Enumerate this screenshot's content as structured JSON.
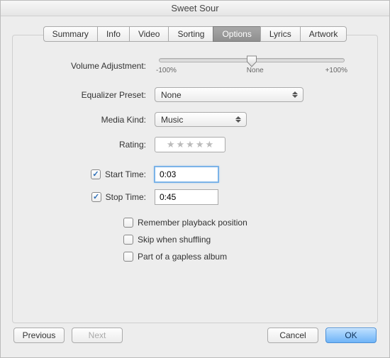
{
  "window": {
    "title": "Sweet Sour"
  },
  "tabs": {
    "items": [
      {
        "label": "Summary"
      },
      {
        "label": "Info"
      },
      {
        "label": "Video"
      },
      {
        "label": "Sorting"
      },
      {
        "label": "Options"
      },
      {
        "label": "Lyrics"
      },
      {
        "label": "Artwork"
      }
    ],
    "active_index": 4
  },
  "volume": {
    "label": "Volume Adjustment:",
    "ticks": {
      "min": "-100%",
      "mid": "None",
      "max": "+100%"
    },
    "value_percent": 50
  },
  "equalizer": {
    "label": "Equalizer Preset:",
    "value": "None"
  },
  "media_kind": {
    "label": "Media Kind:",
    "value": "Music"
  },
  "rating": {
    "label": "Rating:",
    "stars": 0
  },
  "start_time": {
    "label": "Start Time:",
    "checked": true,
    "value": "0:03"
  },
  "stop_time": {
    "label": "Stop Time:",
    "checked": true,
    "value": "0:45"
  },
  "remember": {
    "label": "Remember playback position",
    "checked": false
  },
  "skip": {
    "label": "Skip when shuffling",
    "checked": false
  },
  "gapless": {
    "label": "Part of a gapless album",
    "checked": false
  },
  "footer": {
    "previous": "Previous",
    "next": "Next",
    "cancel": "Cancel",
    "ok": "OK"
  }
}
